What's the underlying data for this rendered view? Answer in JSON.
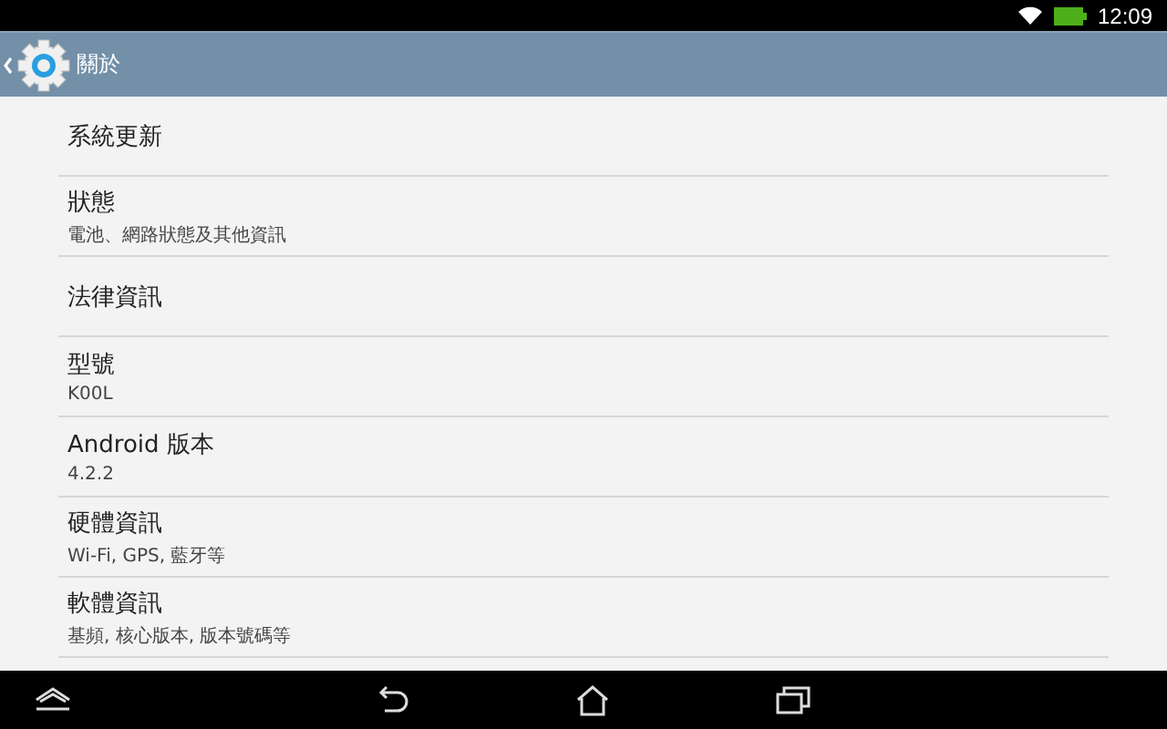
{
  "status_bar": {
    "time": "12:09"
  },
  "action_bar": {
    "title": "關於"
  },
  "items": [
    {
      "title": "系統更新"
    },
    {
      "title": "狀態",
      "summary": "電池、網路狀態及其他資訊"
    },
    {
      "title": "法律資訊"
    },
    {
      "title": "型號",
      "summary": "K00L"
    },
    {
      "title": "Android 版本",
      "summary": "4.2.2"
    },
    {
      "title": "硬體資訊",
      "summary": "Wi-Fi, GPS, 藍牙等"
    },
    {
      "title": "軟體資訊",
      "summary": "基頻, 核心版本, 版本號碼等"
    }
  ]
}
